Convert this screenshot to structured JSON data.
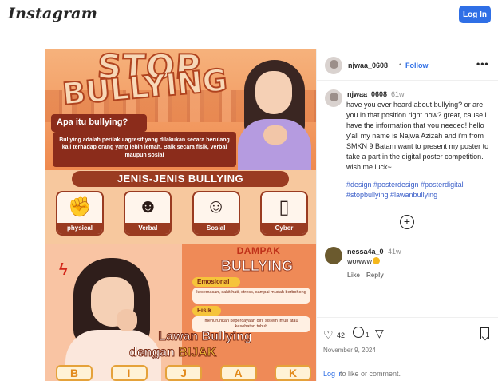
{
  "header": {
    "logo": "Instagram",
    "login_label": "Log In"
  },
  "poster": {
    "title_line1": "STOP",
    "title_line2": "BULLYING",
    "question": "Apa itu bullying?",
    "definition": "Bullying adalah perilaku agresif yang dilakukan secara berulang kali terhadap orang yang lebih lemah. Baik secara fisik, verbal maupun sosial",
    "types_heading": "JENIS-JENIS BULLYING",
    "types": [
      {
        "label": "physical",
        "icon": "physical-icon"
      },
      {
        "label": "Verbal",
        "icon": "verbal-icon"
      },
      {
        "label": "Sosial",
        "icon": "social-icon"
      },
      {
        "label": "Cyber",
        "icon": "phone-icon"
      }
    ],
    "impact_heading": "DAMPAK",
    "impact_subheading": "BULLYING",
    "impact_emotional_label": "Emosional",
    "impact_emotional_text": "kecemasan, sakit hati, stress, sampai mudah berbohong",
    "impact_physical_label": "Fisik",
    "impact_physical_text": "menurunkan kepercayaan diri, sistem imun atau kesehatan tubuh",
    "slogan_line1": "Lawan Bullying",
    "slogan_line2_prefix": "dengan",
    "slogan_line2_highlight": "BIJAK",
    "letters": [
      "B",
      "I",
      "J",
      "A",
      "K"
    ]
  },
  "post_header": {
    "username": "njwaa_0608",
    "separator": "•",
    "follow_label": "Follow",
    "more_label": "•••"
  },
  "caption": {
    "username": "njwaa_0608",
    "time": "61w",
    "text": "have you ever heard about bullying? or are you in that position right now? great, cause i have the information that you needed! hello y'all my name is Najwa Azizah and i'm from SMKN 9 Batam want to present my poster to take a part in the digital poster competition. wish me luck~",
    "hashtags": "#design #posterdesign #posterdigital #stopbullying #lawanbullying"
  },
  "comment": {
    "username": "nessa4a_0",
    "time": "41w",
    "text": "wowww",
    "like_label": "Like",
    "reply_label": "Reply"
  },
  "actions": {
    "likes": "42",
    "comments": "1",
    "date": "November 9, 2024"
  },
  "footer": {
    "login_link": "Log in",
    "login_rest": "to like or comment."
  },
  "colors": {
    "accent": "#2f6fe6",
    "poster_brown": "#9a3b21",
    "poster_orange": "#ef8a57"
  }
}
